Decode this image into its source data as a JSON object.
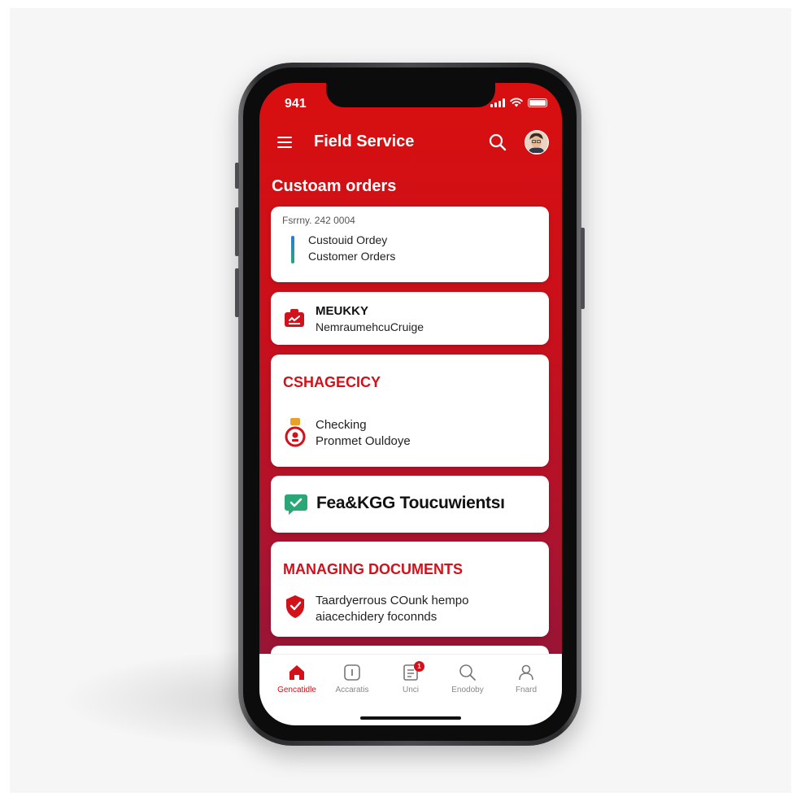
{
  "status": {
    "time": "941"
  },
  "appbar": {
    "title": "Field Service"
  },
  "section_title": "Custoam orders",
  "cards": [
    {
      "date": "Fsrrny. 242 0004",
      "line1": "Custouid Ordey",
      "line2": "Customer Orders"
    },
    {
      "title": "MEUKKY",
      "subtitle": "NemraumehcuCruige"
    },
    {
      "title": "CSHAGECICY",
      "line1": "Checking",
      "line2": "Pronmet Ouldoye"
    },
    {
      "title": "Fea&KGG Toucuwientsı"
    },
    {
      "title": "MANAGING DOCUMENTS",
      "line1": "Taardyerrous COunk hempo",
      "line2": "aiacechidery foconnds"
    }
  ],
  "tabs": [
    {
      "label": "Gencatidle",
      "icon": "home-icon",
      "active": true
    },
    {
      "label": "Accaratis",
      "icon": "info-icon",
      "active": false
    },
    {
      "label": "Unci",
      "icon": "document-icon",
      "active": false,
      "badge": "1"
    },
    {
      "label": "Enodoby",
      "icon": "search-icon",
      "active": false
    },
    {
      "label": "Fnard",
      "icon": "person-icon",
      "active": false
    }
  ],
  "colors": {
    "brand_red": "#d3111a",
    "header_red": "#d90f0f",
    "accent_green": "#2aa776"
  }
}
